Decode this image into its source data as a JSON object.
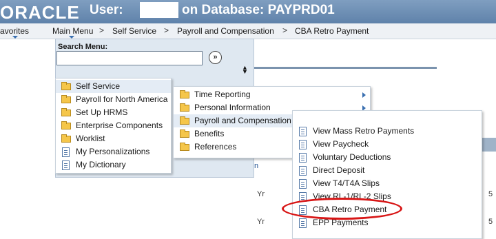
{
  "header": {
    "logo": "ORACLE",
    "user_label": "User:",
    "database_text": "on Database: PAYPRD01"
  },
  "nav": {
    "items": [
      {
        "label": "avorites"
      },
      {
        "label": "Main Menu"
      },
      {
        "label": "Self Service"
      },
      {
        "label": "Payroll and Compensation"
      },
      {
        "label": "CBA Retro Payment"
      }
    ],
    "separator": ">"
  },
  "search": {
    "label": "Search Menu:",
    "value": "",
    "go_glyph": "»"
  },
  "menu_level1": [
    {
      "label": "Self Service",
      "icon": "folder-icon"
    },
    {
      "label": "Payroll for North America",
      "icon": "folder-icon"
    },
    {
      "label": "Set Up HRMS",
      "icon": "folder-icon"
    },
    {
      "label": "Enterprise Components",
      "icon": "folder-icon"
    },
    {
      "label": "Worklist",
      "icon": "folder-icon"
    },
    {
      "label": "My Personalizations",
      "icon": "document-icon"
    },
    {
      "label": "My Dictionary",
      "icon": "document-icon"
    }
  ],
  "menu_level2": [
    {
      "label": "Time Reporting",
      "icon": "folder-icon"
    },
    {
      "label": "Personal Information",
      "icon": "folder-icon"
    },
    {
      "label": "Payroll and Compensation",
      "icon": "folder-icon"
    },
    {
      "label": "Benefits",
      "icon": "folder-icon"
    },
    {
      "label": "References",
      "icon": "folder-icon"
    }
  ],
  "menu_level3": [
    {
      "label": "View Mass Retro Payments",
      "icon": "document-icon"
    },
    {
      "label": "View Paycheck",
      "icon": "document-icon"
    },
    {
      "label": "Voluntary Deductions",
      "icon": "document-icon"
    },
    {
      "label": "Direct Deposit",
      "icon": "document-icon"
    },
    {
      "label": "View T4/T4A Slips",
      "icon": "document-icon"
    },
    {
      "label": "View RL-1/RL-2 Slips",
      "icon": "document-icon"
    },
    {
      "label": "CBA Retro Payment",
      "icon": "document-icon"
    },
    {
      "label": "EPP Payments",
      "icon": "document-icon"
    }
  ],
  "background_fragments": {
    "link_fragment": "n",
    "yr_1": "Yr",
    "yr_2": "Yr",
    "right_1": "5",
    "right_2": "5"
  },
  "colors": {
    "banner": "#6f90b6",
    "highlight_circle": "#d81616",
    "menu_highlight": "#e4ecf5"
  }
}
